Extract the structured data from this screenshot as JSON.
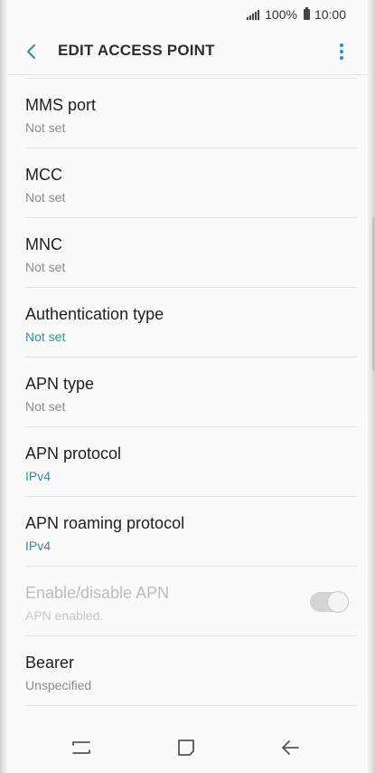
{
  "status_bar": {
    "battery_percent": "100%",
    "time": "10:00"
  },
  "app_bar": {
    "title": "EDIT ACCESS POINT",
    "back_icon": "chevron-left-icon",
    "menu_icon": "more-vertical-icon"
  },
  "settings": [
    {
      "label": "MMS port",
      "value": "Not set"
    },
    {
      "label": "MCC",
      "value": "Not set"
    },
    {
      "label": "MNC",
      "value": "Not set"
    },
    {
      "label": "Authentication type",
      "value": "Not set"
    },
    {
      "label": "APN type",
      "value": "Not set"
    },
    {
      "label": "APN protocol",
      "value": "IPv4"
    },
    {
      "label": "APN roaming protocol",
      "value": "IPv4"
    },
    {
      "label": "Enable/disable APN",
      "value": "APN enabled.",
      "toggle_on": true
    },
    {
      "label": "Bearer",
      "value": "Unspecified"
    }
  ],
  "colors": {
    "accent": "#2e8fa8",
    "text_primary": "#1f1f1f",
    "text_secondary": "#8a8a8a",
    "background": "#fafafa"
  },
  "nav_bar": {
    "recents_icon": "recents-icon",
    "home_icon": "home-icon",
    "back_icon": "back-arrow-icon"
  }
}
